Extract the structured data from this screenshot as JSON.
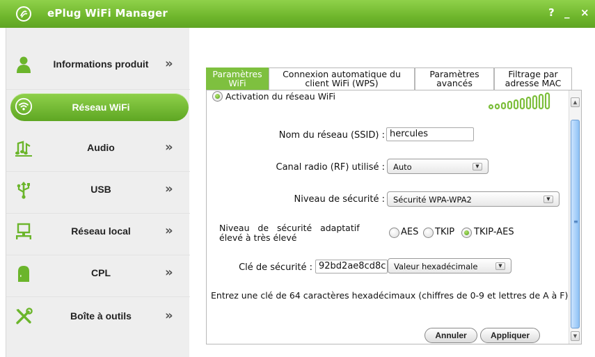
{
  "app": {
    "title": "ePlug WiFi Manager",
    "help_label": "?",
    "minimize_label": "_",
    "close_label": "×"
  },
  "sidebar": {
    "items": [
      {
        "label": "Informations produit",
        "icon": "person-icon",
        "active": false
      },
      {
        "label": "Réseau WiFi",
        "icon": "wifi-icon",
        "active": true
      },
      {
        "label": "Audio",
        "icon": "music-notes-icon",
        "active": false
      },
      {
        "label": "USB",
        "icon": "usb-icon",
        "active": false
      },
      {
        "label": "Réseau local",
        "icon": "network-computer-icon",
        "active": false
      },
      {
        "label": "CPL",
        "icon": "powerline-plug-icon",
        "active": false
      },
      {
        "label": "Boîte à outils",
        "icon": "tools-icon",
        "active": false
      }
    ],
    "chevron": "»"
  },
  "tabs": [
    {
      "label": "Paramètres WiFi",
      "active": true
    },
    {
      "label": "Connexion automatique du client WiFi (WPS)",
      "active": false
    },
    {
      "label": "Paramètres avancés",
      "active": false
    },
    {
      "label": "Filtrage par adresse MAC",
      "active": false
    }
  ],
  "wifi_settings": {
    "activation_label": "Activation du réseau WiFi",
    "activation_on": true,
    "signal_strength_bars": 10,
    "ssid_label": "Nom du réseau (SSID) :",
    "ssid_value": "hercules",
    "channel_label": "Canal radio (RF) utilisé :",
    "channel_value": "Auto",
    "security_label": "Niveau de sécurité :",
    "security_value": "Sécurité WPA-WPA2",
    "adaptive_label_line1": "Niveau   de   sécurité   adaptatif",
    "adaptive_label_line2": "élevé à très élevé",
    "encryption_options": [
      {
        "label": "AES",
        "selected": false
      },
      {
        "label": "TKIP",
        "selected": false
      },
      {
        "label": "TKIP-AES",
        "selected": true
      }
    ],
    "key_label": "Clé de sécurité :",
    "key_value": "92bd2ae8cd8c",
    "key_format_value": "Valeur hexadécimale",
    "info_text": "Entrez une clé de 64 caractères hexadécimaux (chiffres de 0-9 et lettres de A à F)",
    "cancel_label": "Annuler",
    "apply_label": "Appliquer"
  },
  "colors": {
    "accent_green": "#7ec03f",
    "title_bar_green": "#6fb62c",
    "scroll_blue": "#8fc2f5"
  }
}
